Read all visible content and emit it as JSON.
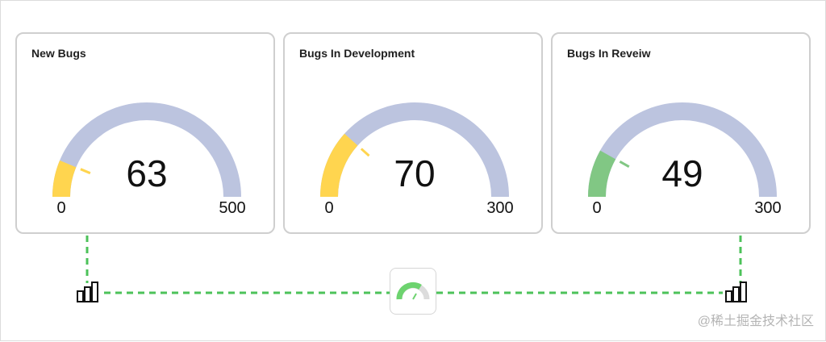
{
  "colors": {
    "track": "#bcc4df",
    "yellow": "#ffd54f",
    "green": "#81c784",
    "connector": "#4cc25a"
  },
  "cards": [
    {
      "title": "New Bugs",
      "value": 63,
      "min": 0,
      "max": 500,
      "color": "#ffd54f",
      "value_text": "63",
      "min_text": "0",
      "max_text": "500"
    },
    {
      "title": "Bugs In Development",
      "value": 70,
      "min": 0,
      "max": 300,
      "color": "#ffd54f",
      "value_text": "70",
      "min_text": "0",
      "max_text": "300"
    },
    {
      "title": "Bugs In Reveiw",
      "value": 49,
      "min": 0,
      "max": 300,
      "color": "#81c784",
      "value_text": "49",
      "min_text": "0",
      "max_text": "300"
    }
  ],
  "icons": {
    "left": "bar-chart-icon",
    "center": "gauge-icon",
    "right": "bar-chart-icon"
  },
  "watermark": "@稀土掘金技术社区"
}
